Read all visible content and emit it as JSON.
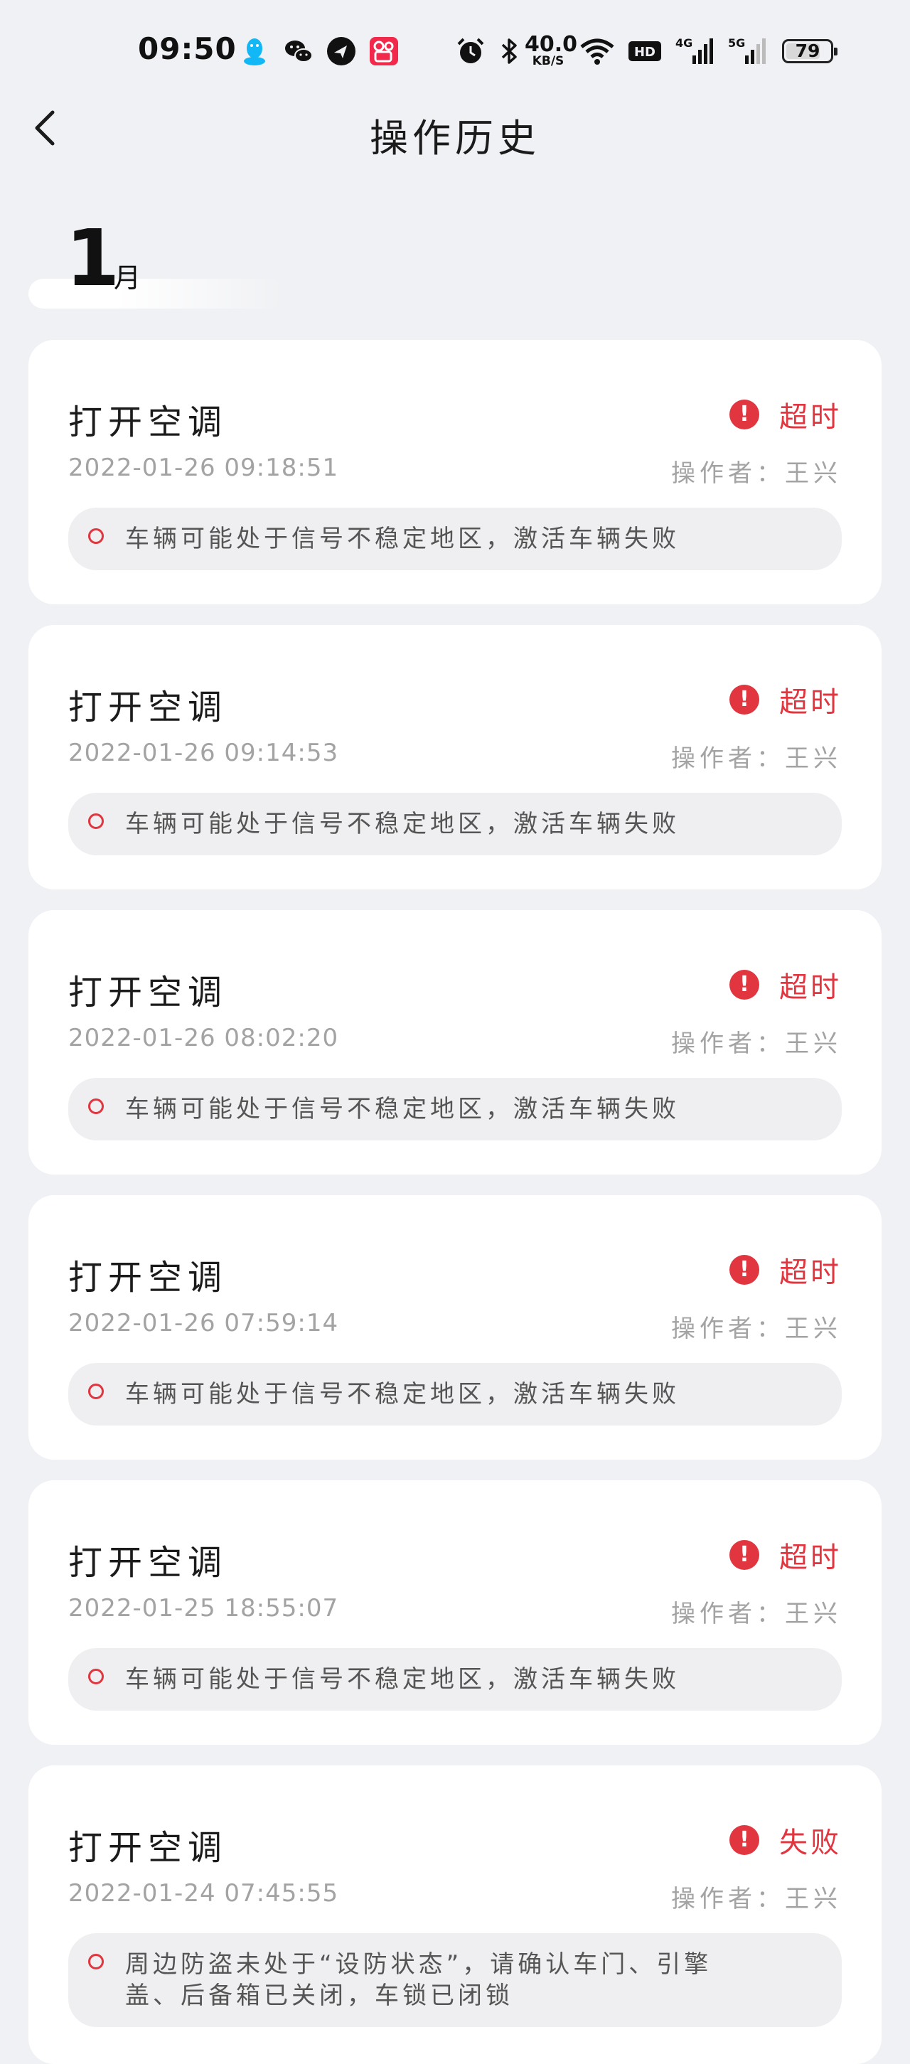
{
  "status_bar": {
    "time": "09:50",
    "net_speed_value": "40.0",
    "net_speed_unit": "KB/S",
    "battery": "79",
    "battery_level": 0.79,
    "icons": [
      "qq-icon",
      "wechat-icon",
      "feishu-icon",
      "kuaishou-icon",
      "alarm-icon",
      "bluetooth-icon",
      "wifi-icon",
      "hd-icon",
      "signal-4g-icon",
      "signal-5g-icon",
      "battery-icon"
    ]
  },
  "nav": {
    "back_icon": "chevron-left-icon",
    "title": "操作历史"
  },
  "month": {
    "number": "1",
    "unit": "月"
  },
  "colors": {
    "accent_red": "#e1363f",
    "background": "#f0f1f4",
    "card": "#ffffff",
    "muted_text": "#a3a3a3"
  },
  "records": [
    {
      "title": "打开空调",
      "status": "超时",
      "time": "2022-01-26 09:18:51",
      "operator": "操作者：王兴",
      "message": "车辆可能处于信号不稳定地区，激活车辆失败"
    },
    {
      "title": "打开空调",
      "status": "超时",
      "time": "2022-01-26 09:14:53",
      "operator": "操作者：王兴",
      "message": "车辆可能处于信号不稳定地区，激活车辆失败"
    },
    {
      "title": "打开空调",
      "status": "超时",
      "time": "2022-01-26 08:02:20",
      "operator": "操作者：王兴",
      "message": "车辆可能处于信号不稳定地区，激活车辆失败"
    },
    {
      "title": "打开空调",
      "status": "超时",
      "time": "2022-01-26 07:59:14",
      "operator": "操作者：王兴",
      "message": "车辆可能处于信号不稳定地区，激活车辆失败"
    },
    {
      "title": "打开空调",
      "status": "超时",
      "time": "2022-01-25 18:55:07",
      "operator": "操作者：王兴",
      "message": "车辆可能处于信号不稳定地区，激活车辆失败"
    },
    {
      "title": "打开空调",
      "status": "失败",
      "time": "2022-01-24 07:45:55",
      "operator": "操作者：王兴",
      "message": "周边防盗未处于“设防状态”，请确认车门、引擎盖、后备箱已关闭，车锁已闭锁"
    }
  ]
}
